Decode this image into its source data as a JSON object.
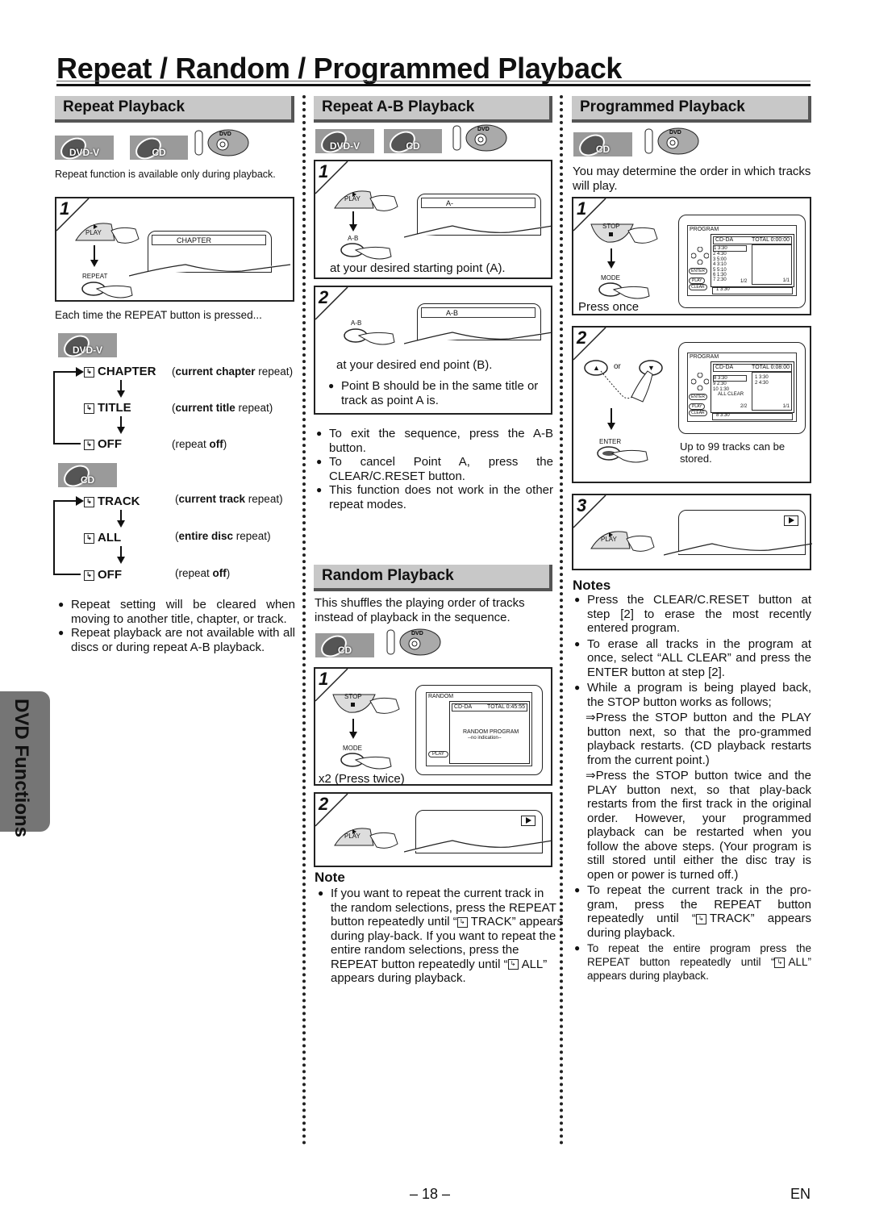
{
  "page": {
    "title": "Repeat / Random / Programmed Playback",
    "side_tab": "DVD Functions",
    "page_number": "– 18 –",
    "language": "EN"
  },
  "repeat": {
    "heading": "Repeat Playback",
    "badges": [
      "DVD-V",
      "CD"
    ],
    "remote_icon_label": "DVD",
    "intro": "Repeat function is available only during playback.",
    "step1": {
      "number": "1",
      "buttons": [
        "PLAY",
        "REPEAT"
      ],
      "screen_text": "CHAPTER"
    },
    "each_time": "Each time the REPEAT button is pressed...",
    "dvd_badge": "DVD-V",
    "dvd_modes": [
      {
        "label": "CHAPTER",
        "desc_bold": "current chapter",
        "desc_rest": " repeat"
      },
      {
        "label": "TITLE",
        "desc_bold": "current title",
        "desc_rest": " repeat"
      },
      {
        "label": "OFF",
        "desc_pre": "repeat ",
        "desc_bold": "off"
      }
    ],
    "cd_badge": "CD",
    "cd_modes": [
      {
        "label": "TRACK",
        "desc_bold": "current track",
        "desc_rest": " repeat"
      },
      {
        "label": "ALL",
        "desc_bold": "entire disc",
        "desc_rest": " repeat"
      },
      {
        "label": "OFF",
        "desc_pre": "repeat ",
        "desc_bold": "off"
      }
    ],
    "notes": [
      "Repeat setting will be cleared when moving to another title, chapter, or track.",
      "Repeat playback are not available with all discs or during repeat A-B playback."
    ]
  },
  "ab": {
    "heading": "Repeat A-B Playback",
    "badges": [
      "DVD-V",
      "CD"
    ],
    "remote_icon_label": "DVD",
    "step1": {
      "number": "1",
      "buttons": [
        "PLAY",
        "A-B"
      ],
      "screen_text": "A-",
      "caption": "at your desired starting point (A)."
    },
    "step2": {
      "number": "2",
      "buttons": [
        "A-B"
      ],
      "screen_text": "A-B",
      "caption": "at your desired end point (B).",
      "note": "Point B should be in the same title or track as point A is."
    },
    "notes": [
      "To exit the sequence, press the A-B button.",
      "To cancel Point A, press the CLEAR/C.RESET button.",
      "This function does not work in the other repeat modes."
    ]
  },
  "random": {
    "heading": "Random Playback",
    "intro": "This shuffles the playing order of tracks instead of playback in the sequence.",
    "badge": "CD",
    "remote_icon_label": "DVD",
    "step1": {
      "number": "1",
      "buttons": [
        "STOP",
        "MODE"
      ],
      "caption": "x2 (Press twice)",
      "osd": {
        "title": "RANDOM",
        "disc": "CD-DA",
        "total": "TOTAL 0:45:55",
        "line1": "RANDOM PROGRAM",
        "line2": "--no indication--",
        "play": "PLAY"
      }
    },
    "step2": {
      "number": "2",
      "buttons": [
        "PLAY"
      ],
      "screen_icon": "play-indicator"
    },
    "note_heading": "Note",
    "note": {
      "p1": "If you want to repeat the current track in the random selections, press the REPEAT button repeatedly until “",
      "p1_mode": "TRACK",
      "p2": "” appears during play-back. If you want to repeat the entire random selections, press the REPEAT button repeatedly until “",
      "p2_mode": "ALL",
      "p3": "” appears during playback."
    }
  },
  "program": {
    "heading": "Programmed Playback",
    "badge": "CD",
    "remote_icon_label": "DVD",
    "intro": "You may determine the order in which tracks will play.",
    "step1": {
      "number": "1",
      "buttons": [
        "STOP",
        "MODE"
      ],
      "caption": "Press once",
      "osd": {
        "title": "PROGRAM",
        "disc": "CD-DA",
        "total": "TOTAL 0:00:00",
        "tracks": [
          "1  3:30",
          "2  4:30",
          "3  5:00",
          "4  3:10",
          "5  5:10",
          "6  1:30",
          "7  2:30"
        ],
        "page_left": "1/2",
        "page_right": "1/1",
        "bottom": "1  3:30",
        "keys": [
          "ENTER",
          "PLAY",
          "CLEAR"
        ]
      }
    },
    "step2": {
      "number": "2",
      "buttons": [
        "▲",
        "▼",
        "ENTER"
      ],
      "or": "or",
      "caption": "Up to 99 tracks can be stored.",
      "osd": {
        "title": "PROGRAM",
        "disc": "CD-DA",
        "total": "TOTAL 0:08:00",
        "tracks": [
          "8  3:30",
          "9  2:30",
          "10 1:30",
          "ALL CLEAR"
        ],
        "selected": [
          "1  3:30",
          "2  4:30"
        ],
        "page_left": "2/2",
        "page_right": "1/1",
        "bottom": "8  3:30",
        "keys": [
          "ENTER",
          "PLAY",
          "CLEAR"
        ]
      }
    },
    "step3": {
      "number": "3",
      "buttons": [
        "PLAY"
      ]
    },
    "notes_heading": "Notes",
    "notes": [
      "Press the CLEAR/C.RESET button at step [2] to erase the most recently entered program.",
      "To erase all tracks in the program at once, select “ALL CLEAR” and press the ENTER button at step [2].",
      "While a program is being played back, the STOP button works as follows;"
    ],
    "sub_notes": [
      "⇒Press the STOP button and the PLAY button next, so that the pro-grammed playback restarts. (CD playback restarts from the current point.)",
      "⇒Press the STOP button twice and the PLAY button next, so that play-back restarts from the first track in the original order. However, your programmed playback can be restarted when you follow the above steps. (Your program is still stored until either the disc tray is open or power is turned off.)"
    ],
    "note4": {
      "pre": "To repeat the current track in the pro-gram, press the REPEAT button repeatedly until “",
      "mode": "TRACK",
      "post": "” appears during playback."
    },
    "note5": {
      "pre": "To repeat the entire program press the REPEAT button repeatedly until “",
      "mode": "ALL",
      "post": "” appears during playback."
    }
  }
}
